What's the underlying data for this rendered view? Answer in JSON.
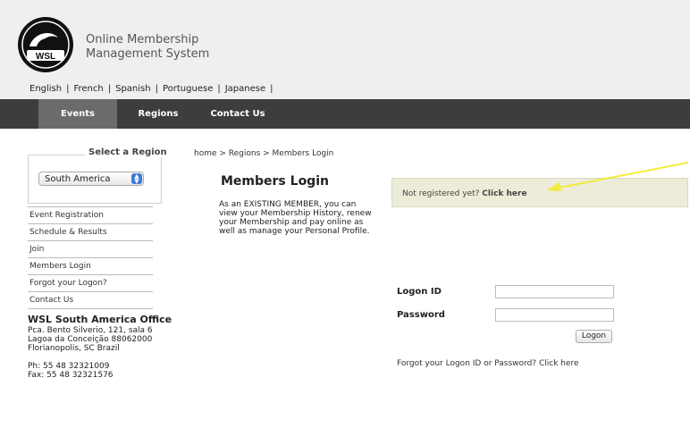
{
  "header": {
    "logo_text": "WSL",
    "app_title_line1": "Online Membership",
    "app_title_line2": "Management System"
  },
  "languages": [
    "English",
    "French",
    "Spanish",
    "Portuguese",
    "Japanese"
  ],
  "nav": {
    "tabs": [
      {
        "label": "Events"
      },
      {
        "label": "Regions"
      },
      {
        "label": "Contact Us"
      }
    ]
  },
  "sidebar": {
    "region_legend": "Select a Region",
    "region_selected": "South America",
    "menu": [
      {
        "label": "Event Registration"
      },
      {
        "label": "Schedule & Results"
      },
      {
        "label": "Join"
      },
      {
        "label": "Members Login"
      },
      {
        "label": "Forgot your Logon?"
      },
      {
        "label": "Contact Us"
      }
    ],
    "office": {
      "title": "WSL South America Office",
      "line1": "Pca. Bento Silverio, 121, sala 6",
      "line2": "Lagoa da Conceição 88062000",
      "line3": "Florianopolis, SC Brazil",
      "phone": "Ph: 55 48 32321009",
      "fax": "Fax: 55 48 32321576"
    }
  },
  "main": {
    "breadcrumb": "home > Regions > Members Login",
    "title": "Members Login",
    "intro": "As an EXISTING MEMBER, you can view your Membership History, renew your Membership and pay online as well as manage your Personal Profile.",
    "register_prompt": "Not registered yet?",
    "register_link": "Click here",
    "logon_id_label": "Logon ID",
    "password_label": "Password",
    "logon_button": "Logon",
    "forgot_text": "Forgot your Logon ID or Password?",
    "forgot_link": "Click here"
  },
  "colors": {
    "nav_bg": "#3d3d3d",
    "nav_active": "#6b6b6b",
    "register_bg": "#ececd8",
    "annotation_arrow": "#f2ec3a"
  }
}
